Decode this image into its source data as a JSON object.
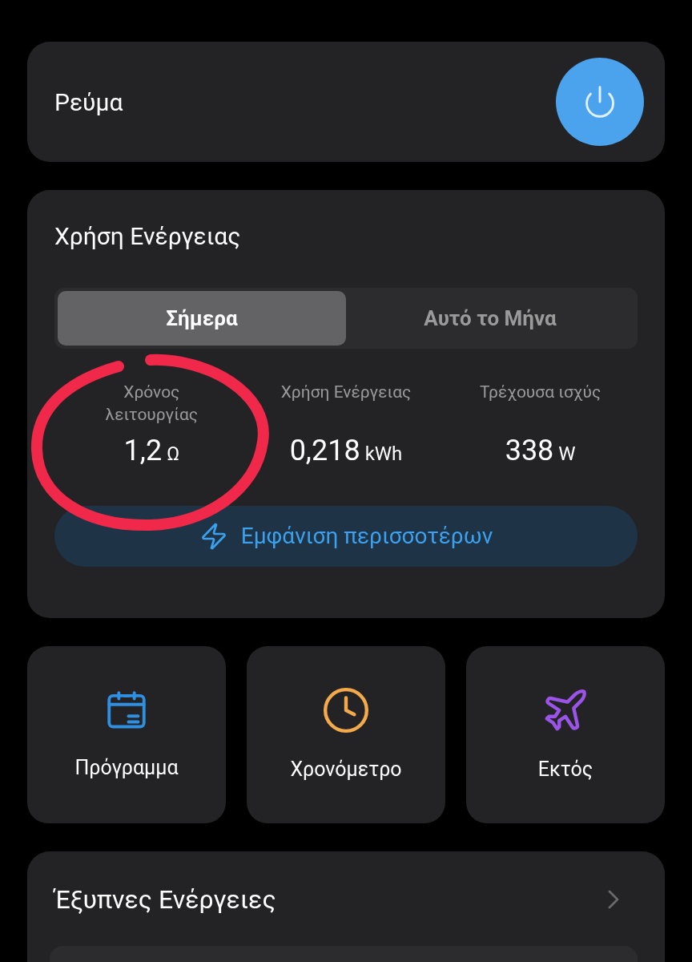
{
  "power": {
    "title": "Ρεύμα",
    "on": true
  },
  "energy": {
    "title": "Χρήση Ενέργειας",
    "tabs": [
      {
        "label": "Σήμερα",
        "selected": true
      },
      {
        "label": "Αυτό το Μήνα",
        "selected": false
      }
    ],
    "stats": [
      {
        "label": "Χρόνος λειτουργίας",
        "value": "1,2",
        "unit": "Ω"
      },
      {
        "label": "Χρήση Ενέργειας",
        "value": "0,218",
        "unit": "kWh"
      },
      {
        "label": "Τρέχουσα ισχύς",
        "value": "338",
        "unit": "W"
      }
    ],
    "more_button": "Εμφάνιση περισσοτέρων"
  },
  "annotation": {
    "kind": "circle",
    "color": "#f0284a"
  },
  "shortcuts": [
    {
      "kind": "calendar",
      "label": "Πρόγραμμα",
      "color": "#2f8fe0"
    },
    {
      "kind": "clock",
      "label": "Χρονόμετρο",
      "color": "#f4a94b"
    },
    {
      "kind": "plane",
      "label": "Εκτός",
      "color": "#9b54e8"
    }
  ],
  "smart": {
    "title": "Έξυπνες Ενέργειες"
  }
}
